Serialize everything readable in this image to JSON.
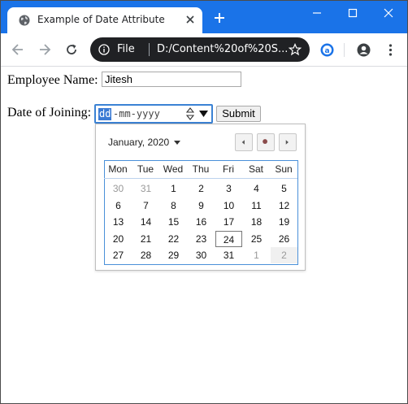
{
  "browser": {
    "tab_title": "Example of Date Attribute",
    "omnibox": {
      "scheme": "File",
      "url": "D:/Content%20of%20S..."
    }
  },
  "form": {
    "employee_label": "Employee Name:",
    "employee_value": "Jitesh",
    "doj_label": "Date of Joining:",
    "date_day_placeholder": "dd",
    "date_rest_placeholder": "-mm-yyyy",
    "submit_label": "Submit"
  },
  "calendar": {
    "month_label": "January, 2020",
    "weekdays": [
      "Mon",
      "Tue",
      "Wed",
      "Thu",
      "Fri",
      "Sat",
      "Sun"
    ],
    "weeks": [
      [
        "30",
        "31",
        "1",
        "2",
        "3",
        "4",
        "5"
      ],
      [
        "6",
        "7",
        "8",
        "9",
        "10",
        "11",
        "12"
      ],
      [
        "13",
        "14",
        "15",
        "16",
        "17",
        "18",
        "19"
      ],
      [
        "20",
        "21",
        "22",
        "23",
        "24",
        "25",
        "26"
      ],
      [
        "27",
        "28",
        "29",
        "30",
        "31",
        "1",
        "2"
      ]
    ],
    "today": "24",
    "colors": {
      "accent": "#1a73e8",
      "selection": "#3b7bd4",
      "omnibox": "#202124"
    }
  }
}
